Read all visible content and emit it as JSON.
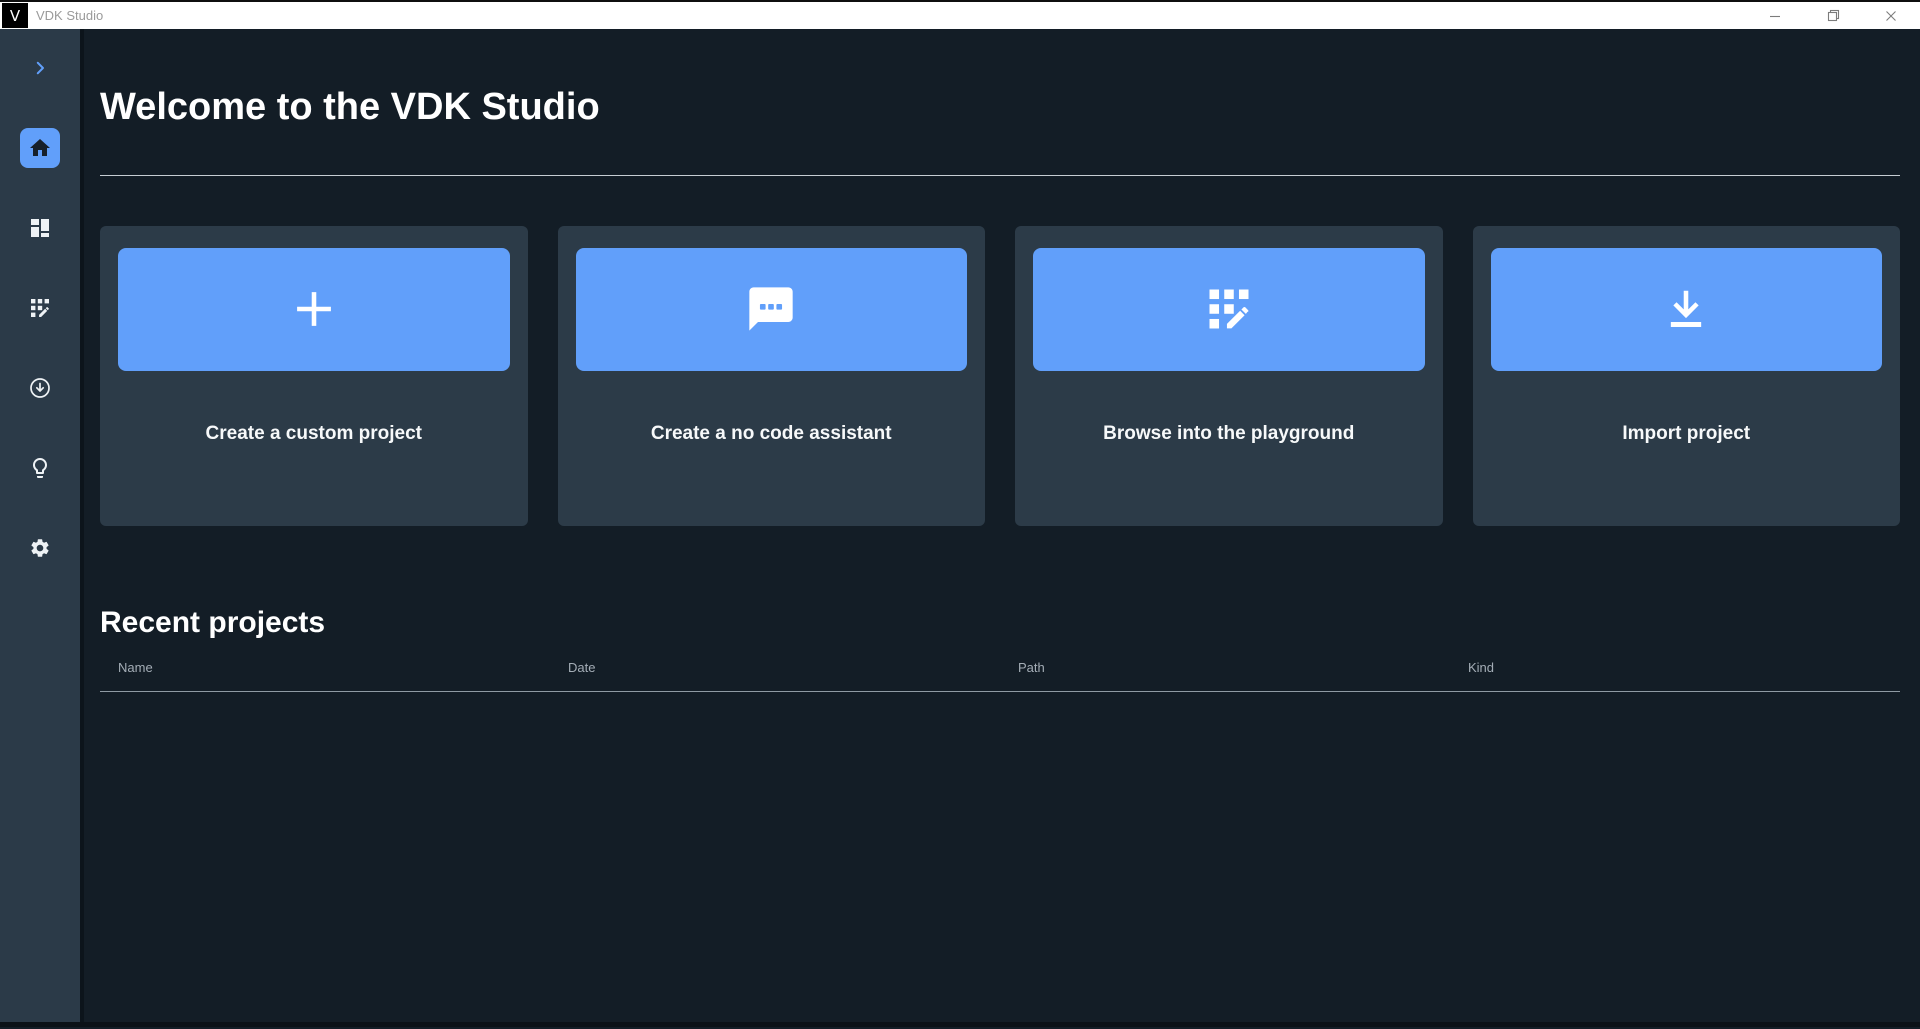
{
  "window": {
    "title": "VDK Studio",
    "logo_letter": "V",
    "controls": {
      "minimize_icon": "minimize-icon",
      "restore_icon": "restore-icon",
      "close_icon": "close-icon"
    }
  },
  "sidebar": {
    "active_index": 1,
    "items": [
      {
        "icon": "chevron-right-icon"
      },
      {
        "icon": "home-icon"
      },
      {
        "icon": "dashboard-icon"
      },
      {
        "icon": "app-registration-icon"
      },
      {
        "icon": "download-circle-icon"
      },
      {
        "icon": "lightbulb-icon"
      },
      {
        "icon": "gear-icon"
      }
    ]
  },
  "main": {
    "welcome_title": "Welcome to the VDK Studio",
    "cards": [
      {
        "label": "Create a custom project",
        "icon": "plus-icon"
      },
      {
        "label": "Create a no code assistant",
        "icon": "chat-icon"
      },
      {
        "label": "Browse into the playground",
        "icon": "app-registration-icon"
      },
      {
        "label": "Import project",
        "icon": "download-icon"
      }
    ],
    "recent": {
      "title": "Recent projects",
      "columns": [
        "Name",
        "Date",
        "Path",
        "Kind"
      ],
      "rows": []
    }
  },
  "colors": {
    "accent_blue": "#619ffa",
    "sidebar_bg": "#2b3a48",
    "main_bg": "#131d26",
    "card_bg": "#2c3b48",
    "titlebar_bg": "#ffffff",
    "titlebar_text": "#9a9a9a",
    "muted_text": "#a4adb6"
  }
}
